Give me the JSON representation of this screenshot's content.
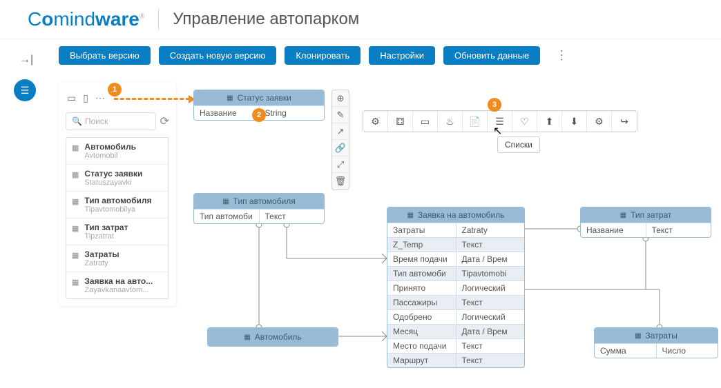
{
  "header": {
    "logo_html": "Comindware",
    "page_title": "Управление автопарком"
  },
  "toolbar": {
    "select_version": "Выбрать версию",
    "new_version": "Создать новую версию",
    "clone": "Клонировать",
    "settings": "Настройки",
    "refresh": "Обновить данные"
  },
  "search": {
    "placeholder": "Поиск"
  },
  "entities": [
    {
      "name": "Автомобиль",
      "sub": "Avtomobil"
    },
    {
      "name": "Статус заявки",
      "sub": "Statuszayavki"
    },
    {
      "name": "Тип автомобиля",
      "sub": "Tipavtomobilya"
    },
    {
      "name": "Тип затрат",
      "sub": "Tipzatrat"
    },
    {
      "name": "Затраты",
      "sub": "Zatraty"
    },
    {
      "name": "Заявка на авто...",
      "sub": "Zayavkanaavtom..."
    }
  ],
  "boxes": {
    "status": {
      "title": "Статус заявки",
      "rows": [
        [
          "Название",
          "String"
        ]
      ]
    },
    "tipavto": {
      "title": "Тип автомобиля",
      "rows": [
        [
          "Тип автомоби",
          "Текст"
        ]
      ]
    },
    "avto": {
      "title": "Автомобиль",
      "rows": []
    },
    "zayavka": {
      "title": "Заявка на автомобиль",
      "rows": [
        [
          "Затраты",
          "Zatraty"
        ],
        [
          "Z_Temp",
          "Текст"
        ],
        [
          "Время подачи",
          "Дата / Врем"
        ],
        [
          "Тип автомоби",
          "Tipavtomobi"
        ],
        [
          "Принято",
          "Логический"
        ],
        [
          "Пассажиры",
          "Текст"
        ],
        [
          "Одобрено",
          "Логический"
        ],
        [
          "Месяц",
          "Дата / Врем"
        ],
        [
          "Место подачи",
          "Текст"
        ],
        [
          "Маршрут",
          "Текст"
        ]
      ]
    },
    "tipzatrat": {
      "title": "Тип затрат",
      "rows": [
        [
          "Название",
          "Текст"
        ]
      ]
    },
    "zatraty": {
      "title": "Затраты",
      "rows": [
        [
          "Сумма",
          "Число"
        ]
      ]
    }
  },
  "tooltip": {
    "text": "Списки"
  },
  "markers": {
    "m1": "1",
    "m2": "2",
    "m3": "3"
  }
}
